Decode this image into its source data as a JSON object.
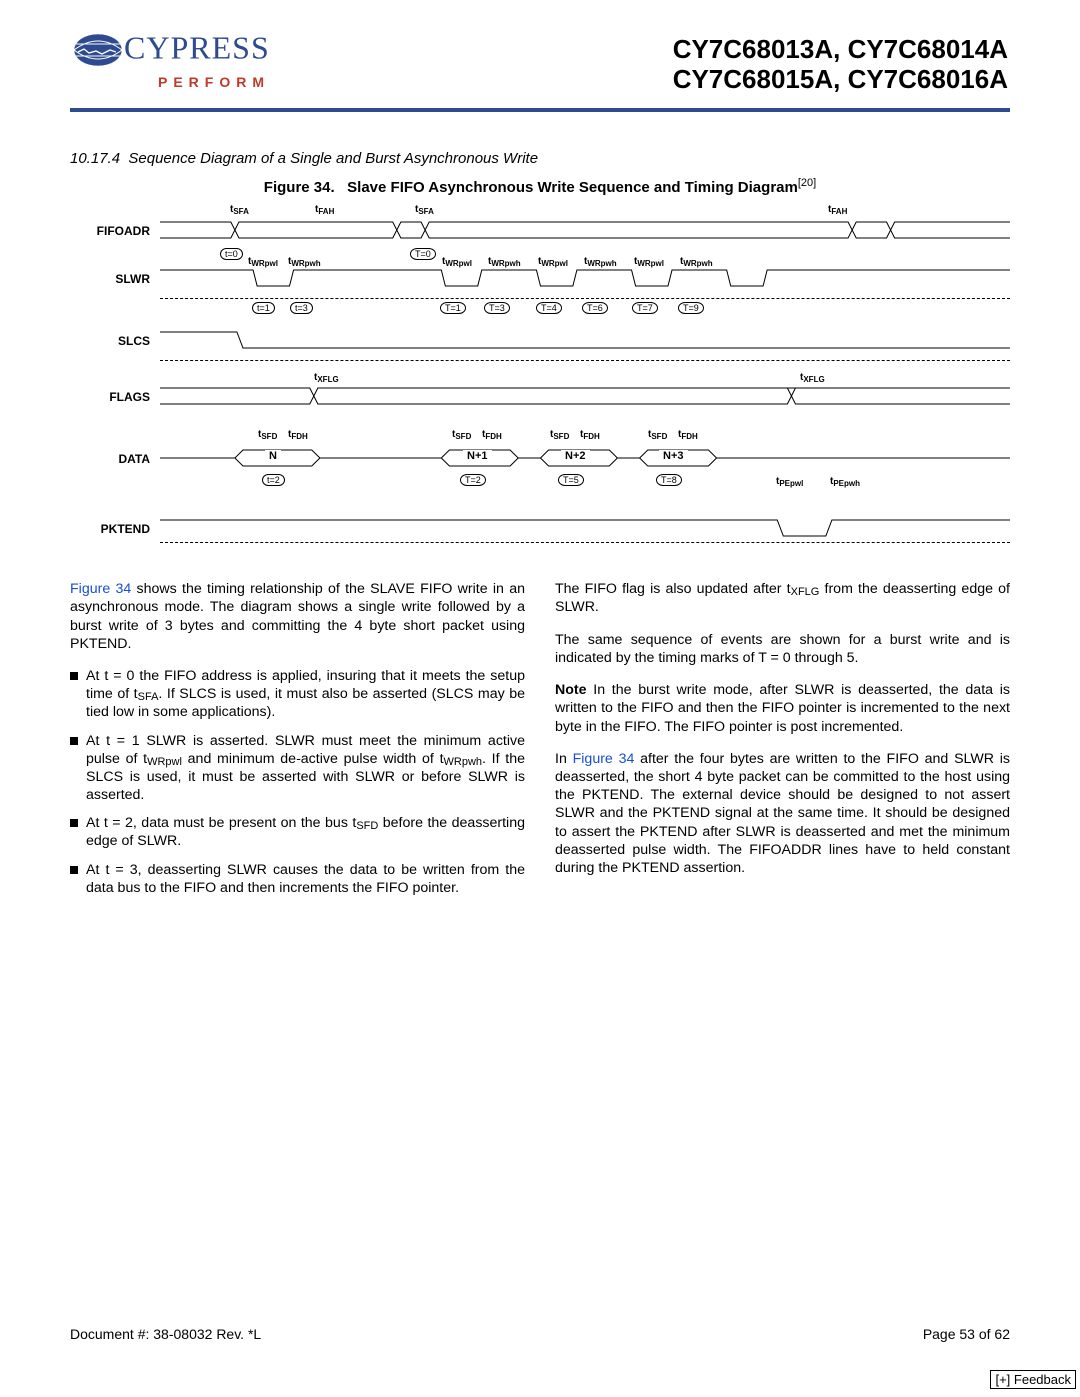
{
  "header": {
    "brand_word": "CYPRESS",
    "tagline": "PERFORM",
    "part_line1": "CY7C68013A, CY7C68014A",
    "part_line2": "CY7C68015A, CY7C68016A"
  },
  "section": {
    "number": "10.17.4",
    "title": "Sequence Diagram of a Single and Burst Asynchronous Write"
  },
  "figure": {
    "label": "Figure 34.",
    "title": "Slave FIFO Asynchronous Write Sequence and Timing Diagram",
    "footnote_num": "[20]"
  },
  "signals": {
    "fifoadr": "FIFOADR",
    "slwr": "SLWR",
    "slcs": "SLCS",
    "flags": "FLAGS",
    "data": "DATA",
    "pktend": "PKTEND"
  },
  "timing_params": {
    "tsfa": "tSFA",
    "tfah": "tFAH",
    "twrpwl": "tWRpwl",
    "twrpwh": "tWRpwh",
    "txflg": "tXFLG",
    "tsfd": "tSFD",
    "tfdh": "tFDH",
    "tpepwl": "tPEpwl",
    "tpepwh": "tPEpwh"
  },
  "t_marks": {
    "t0a": "t=0",
    "t0b": "T=0",
    "t1": "t=1",
    "t3": "t=3",
    "T1": "T=1",
    "T3": "T=3",
    "T4": "T=4",
    "T6": "T=6",
    "T7": "T=7",
    "T9": "T=9",
    "t2": "t=2",
    "T2": "T=2",
    "T5": "T=5",
    "T8": "T=8"
  },
  "data_vals": {
    "n": "N",
    "n1": "N+1",
    "n2": "N+2",
    "n3": "N+3"
  },
  "body": {
    "p1a": "Figure 34",
    "p1b": " shows the timing relationship of the SLAVE FIFO write in an asynchronous mode. The diagram shows a single write followed by a burst write of 3 bytes and committing the 4 byte short packet using PKTEND.",
    "li1a": "At t = 0 the FIFO address is applied, insuring that it meets the setup time of t",
    "li1b": ". If SLCS is used, it must also be asserted (SLCS may be tied low in some applications).",
    "li2a": "At t = 1 SLWR is asserted. SLWR must meet the minimum active pulse of t",
    "li2b": " and minimum de-active pulse width of t",
    "li2c": ". If the SLCS is used, it must be asserted with SLWR or before SLWR is asserted.",
    "li3a": "At t = 2, data must be present on the bus t",
    "li3b": " before the deasserting edge of SLWR.",
    "li4": "At t = 3, deasserting SLWR causes the data to be written from the data bus to the FIFO and then increments the FIFO pointer.",
    "p2a": "The FIFO flag is also updated after t",
    "p2b": " from the deasserting edge of SLWR.",
    "p3": "The same sequence of events are shown for a burst write and is indicated by the timing marks of T = 0 through 5.",
    "p4": " In the burst write mode, after SLWR is deasserted, the data is written to the FIFO and then the FIFO pointer is incremented to the next byte in the FIFO. The FIFO pointer is post incremented.",
    "p5a": "In ",
    "p5b": " after the four bytes are written to the FIFO and SLWR is deasserted, the short 4 byte packet can be committed to the host using the PKTEND. The external device should be designed to not assert SLWR and the PKTEND signal at the same time. It should be designed to assert the PKTEND after SLWR is deasserted and met the minimum deasserted pulse width. The FIFOADDR lines have to held constant during the PKTEND assertion.",
    "note_word": "Note",
    "sub_sfa": "SFA",
    "sub_wrpwl": "WRpwl",
    "sub_wrpwh": "WRpwh",
    "sub_sfd": "SFD",
    "sub_xflg": "XFLG"
  },
  "footer": {
    "doc": "Document #: 38-08032 Rev. *L",
    "page": "Page 53 of 62",
    "feedback": "[+] Feedback"
  }
}
